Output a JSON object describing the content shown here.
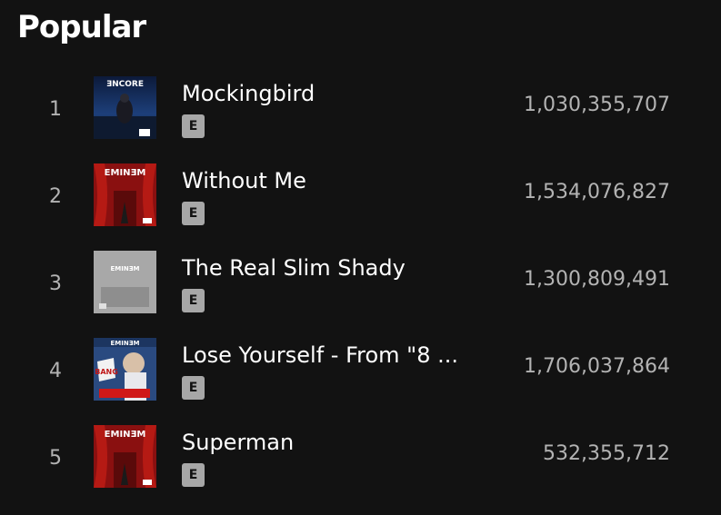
{
  "section": {
    "title": "Popular"
  },
  "tracks": [
    {
      "index": "1",
      "title": "Mockingbird",
      "explicit": "E",
      "plays": "1,030,355,707",
      "cover": {
        "text": "ƎNCORE",
        "art": "album-cover-encore-icon"
      }
    },
    {
      "index": "2",
      "title": "Without Me",
      "explicit": "E",
      "plays": "1,534,076,827",
      "cover": {
        "text": "EMINƎM",
        "art": "album-cover-eminem-show-icon"
      }
    },
    {
      "index": "3",
      "title": "The Real Slim Shady",
      "explicit": "E",
      "plays": "1,300,809,491",
      "cover": {
        "text": "EMINƎM",
        "art": "album-cover-marshall-mathers-lp-icon"
      }
    },
    {
      "index": "4",
      "title": "Lose Yourself - From \"8 ...",
      "explicit": "E",
      "plays": "1,706,037,864",
      "cover": {
        "text": "EMINƎM",
        "art": "album-cover-curtain-call-icon"
      }
    },
    {
      "index": "5",
      "title": "Superman",
      "explicit": "E",
      "plays": "532,355,712",
      "cover": {
        "text": "EMINƎM",
        "art": "album-cover-eminem-show-icon"
      }
    }
  ],
  "colors": {
    "background": "#121212",
    "primary_text": "#ffffff",
    "secondary_text": "#b3b3b3",
    "badge": "#a7a7a7"
  }
}
